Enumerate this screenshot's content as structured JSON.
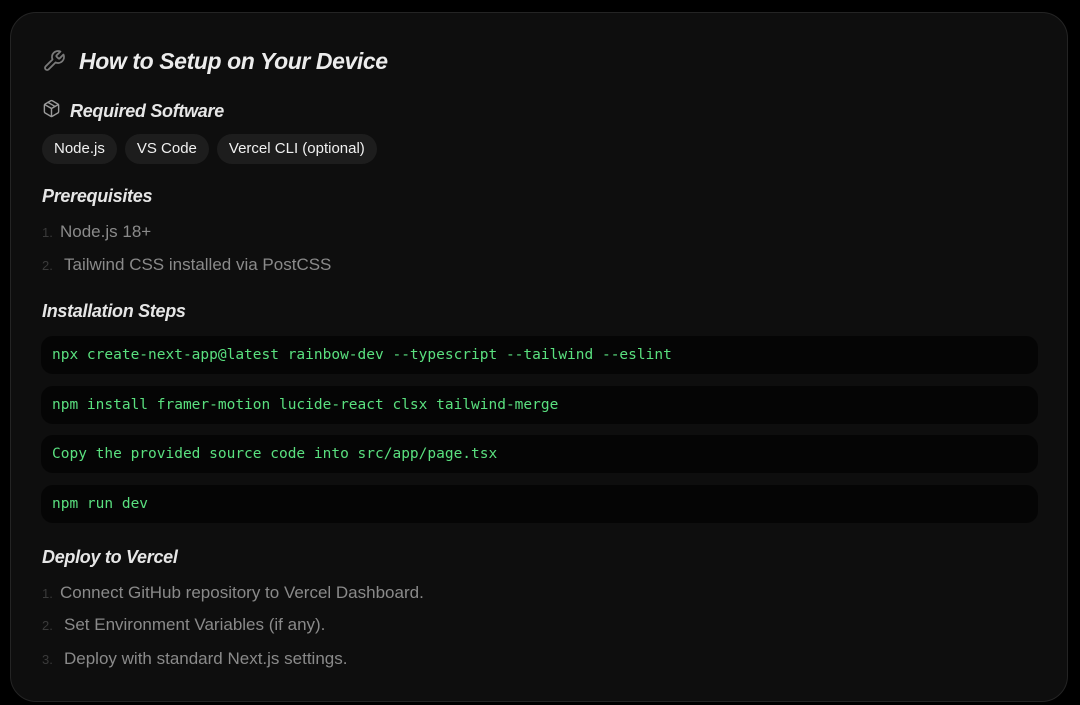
{
  "header": {
    "title": "How to Setup on Your Device",
    "icon": "wrench-icon"
  },
  "required_software": {
    "heading": "Required Software",
    "icon": "package-icon",
    "chips": [
      "Node.js",
      "VS Code",
      "Vercel CLI (optional)"
    ]
  },
  "prerequisites": {
    "heading": "Prerequisites",
    "items": [
      {
        "num": "1.",
        "text": "Node.js 18+"
      },
      {
        "num": "2.",
        "text": "Tailwind CSS installed via PostCSS"
      }
    ]
  },
  "installation": {
    "heading": "Installation Steps",
    "steps": [
      "npx create-next-app@latest rainbow-dev --typescript --tailwind --eslint",
      "npm install framer-motion lucide-react clsx tailwind-merge",
      "Copy the provided source code into src/app/page.tsx",
      "npm run dev"
    ]
  },
  "deploy": {
    "heading": "Deploy to Vercel",
    "items": [
      {
        "num": "1.",
        "text": "Connect GitHub repository to Vercel Dashboard."
      },
      {
        "num": "2.",
        "text": "Set Environment Variables (if any)."
      },
      {
        "num": "3.",
        "text": "Deploy with standard Next.js settings."
      }
    ]
  },
  "colors": {
    "background": "#0e0e0e",
    "code_text": "#5ae07f",
    "heading": "#e6e6e6",
    "muted_text": "#8a8a8a"
  }
}
